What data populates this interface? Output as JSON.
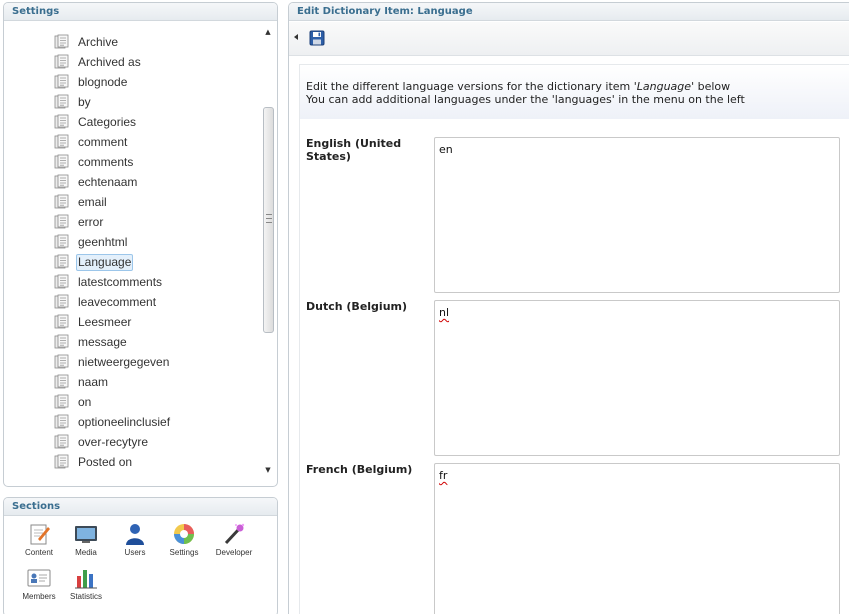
{
  "settings_panel": {
    "title": "Settings",
    "tree_items": [
      {
        "label": "Archive"
      },
      {
        "label": "Archived as"
      },
      {
        "label": "blognode"
      },
      {
        "label": "by"
      },
      {
        "label": "Categories"
      },
      {
        "label": "comment"
      },
      {
        "label": "comments"
      },
      {
        "label": "echtenaam"
      },
      {
        "label": "email"
      },
      {
        "label": "error"
      },
      {
        "label": "geenhtml"
      },
      {
        "label": "Language",
        "selected": true
      },
      {
        "label": "latestcomments"
      },
      {
        "label": "leavecomment"
      },
      {
        "label": "Leesmeer"
      },
      {
        "label": "message"
      },
      {
        "label": "nietweergegeven"
      },
      {
        "label": "naam"
      },
      {
        "label": "on"
      },
      {
        "label": "optioneelinclusief"
      },
      {
        "label": "over-recytyre"
      },
      {
        "label": "Posted on"
      }
    ],
    "scroll_up_icon": "arrow-up-icon",
    "scroll_down_icon": "arrow-down-icon",
    "item_icon": "dictionary-item-icon"
  },
  "sections_panel": {
    "title": "Sections",
    "apps": [
      {
        "label": "Content",
        "icon": "content-icon"
      },
      {
        "label": "Media",
        "icon": "media-icon"
      },
      {
        "label": "Users",
        "icon": "users-icon"
      },
      {
        "label": "Settings",
        "icon": "settings-icon"
      },
      {
        "label": "Developer",
        "icon": "developer-icon"
      },
      {
        "label": "Members",
        "icon": "members-icon"
      },
      {
        "label": "Statistics",
        "icon": "statistics-icon"
      }
    ]
  },
  "edit_panel": {
    "title": "Edit Dictionary Item: Language",
    "intro_line1_before": "Edit the different language versions for the dictionary item '",
    "intro_item": "Language",
    "intro_line1_after": "' below",
    "intro_line2": "You can add additional languages under the 'languages' in the menu on the left",
    "languages": [
      {
        "label": "English (United States)",
        "value": "en"
      },
      {
        "label": "Dutch (Belgium)",
        "value": "nl"
      },
      {
        "label": "French (Belgium)",
        "value": "fr"
      }
    ]
  },
  "colors": {
    "panel_title": "#3a6e8f",
    "panel_border": "#c6cdd3",
    "selected_bg": "#e4f0fb",
    "selected_border": "#9cc6ea"
  }
}
